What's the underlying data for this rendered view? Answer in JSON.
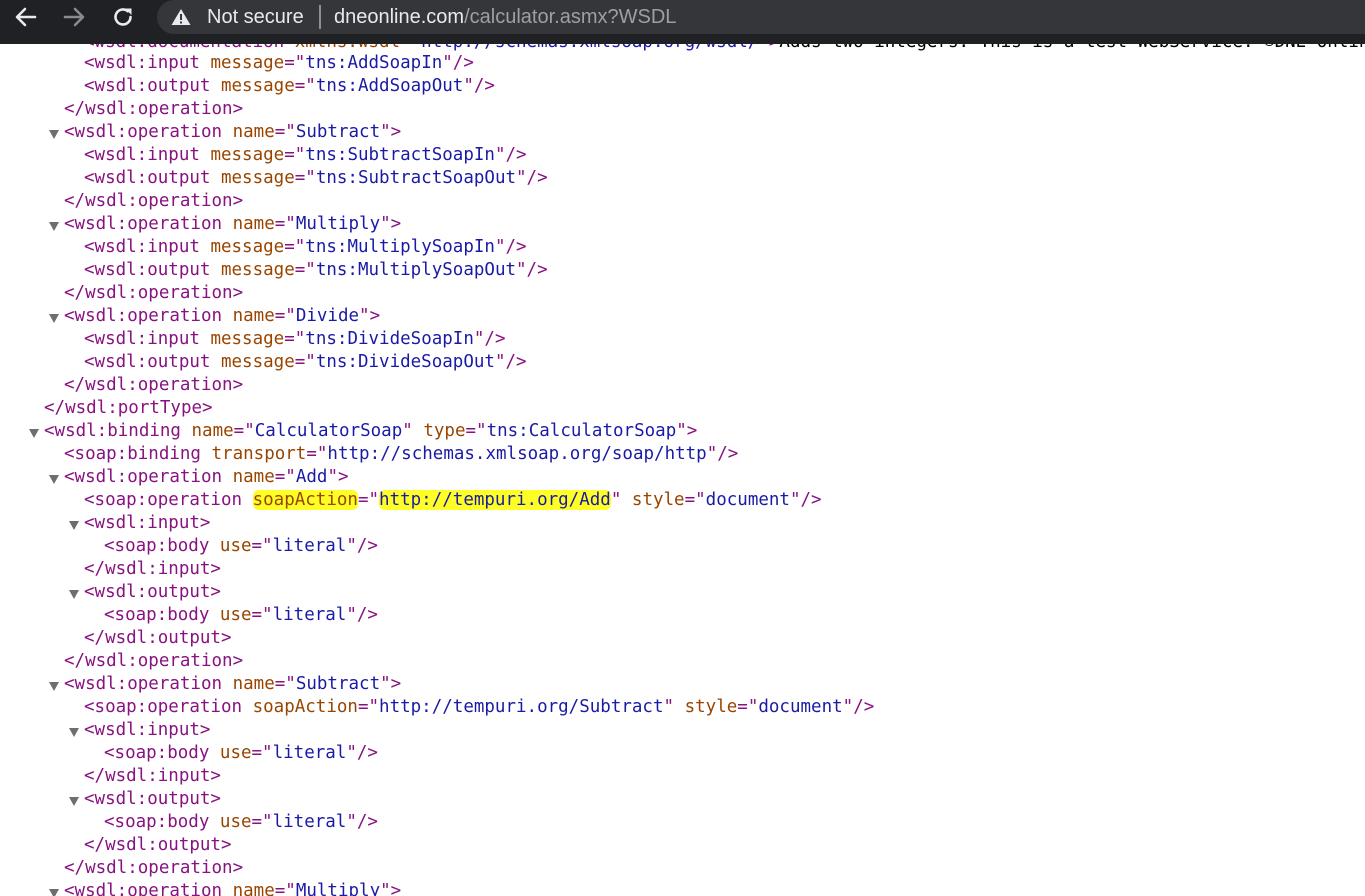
{
  "browser": {
    "security_label": "Not secure",
    "url_host": "dneonline.com",
    "url_path": "/calculator.asmx?WSDL"
  },
  "xml": {
    "doc_partial": {
      "open": "<wsdl:documentation",
      "attr_name": "xmlns:wsdl",
      "attr_value": "http://schemas.xmlsoap.org/wsdl/",
      "text": "Adds two integers. This is a test WebService. ©DNE Online"
    },
    "porttype_add": {
      "input": {
        "tag": "<wsdl:input",
        "attr_name": "message",
        "attr_value": "tns:AddSoapIn"
      },
      "output": {
        "tag": "<wsdl:output",
        "attr_name": "message",
        "attr_value": "tns:AddSoapOut"
      },
      "close": "</wsdl:operation>"
    },
    "porttype_subtract": {
      "open": {
        "tag": "<wsdl:operation",
        "attr_name": "name",
        "attr_value": "Subtract"
      },
      "input": {
        "tag": "<wsdl:input",
        "attr_name": "message",
        "attr_value": "tns:SubtractSoapIn"
      },
      "output": {
        "tag": "<wsdl:output",
        "attr_name": "message",
        "attr_value": "tns:SubtractSoapOut"
      },
      "close": "</wsdl:operation>"
    },
    "porttype_multiply": {
      "open": {
        "tag": "<wsdl:operation",
        "attr_name": "name",
        "attr_value": "Multiply"
      },
      "input": {
        "tag": "<wsdl:input",
        "attr_name": "message",
        "attr_value": "tns:MultiplySoapIn"
      },
      "output": {
        "tag": "<wsdl:output",
        "attr_name": "message",
        "attr_value": "tns:MultiplySoapOut"
      },
      "close": "</wsdl:operation>"
    },
    "porttype_divide": {
      "open": {
        "tag": "<wsdl:operation",
        "attr_name": "name",
        "attr_value": "Divide"
      },
      "input": {
        "tag": "<wsdl:input",
        "attr_name": "message",
        "attr_value": "tns:DivideSoapIn"
      },
      "output": {
        "tag": "<wsdl:output",
        "attr_name": "message",
        "attr_value": "tns:DivideSoapOut"
      },
      "close": "</wsdl:operation>"
    },
    "porttype_close": "</wsdl:portType>",
    "binding": {
      "tag": "<wsdl:binding",
      "name_attr": "name",
      "name_value": "CalculatorSoap",
      "type_attr": "type",
      "type_value": "tns:CalculatorSoap",
      "soap_binding": {
        "tag": "<soap:binding",
        "attr_name": "transport",
        "attr_value": "http://schemas.xmlsoap.org/soap/http"
      }
    },
    "binding_add": {
      "open": {
        "tag": "<wsdl:operation",
        "attr_name": "name",
        "attr_value": "Add"
      },
      "soap_op": {
        "tag": "<soap:operation",
        "action_attr": "soapAction",
        "action_value": "http://tempuri.org/Add",
        "style_attr": "style",
        "style_value": "document"
      },
      "input_open": "<wsdl:input>",
      "input_body": {
        "tag": "<soap:body",
        "attr_name": "use",
        "attr_value": "literal"
      },
      "input_close": "</wsdl:input>",
      "output_open": "<wsdl:output>",
      "output_body": {
        "tag": "<soap:body",
        "attr_name": "use",
        "attr_value": "literal"
      },
      "output_close": "</wsdl:output>",
      "close": "</wsdl:operation>"
    },
    "binding_subtract": {
      "open": {
        "tag": "<wsdl:operation",
        "attr_name": "name",
        "attr_value": "Subtract"
      },
      "soap_op": {
        "tag": "<soap:operation",
        "action_attr": "soapAction",
        "action_value": "http://tempuri.org/Subtract",
        "style_attr": "style",
        "style_value": "document"
      },
      "input_open": "<wsdl:input>",
      "input_body": {
        "tag": "<soap:body",
        "attr_name": "use",
        "attr_value": "literal"
      },
      "input_close": "</wsdl:input>",
      "output_open": "<wsdl:output>",
      "output_body": {
        "tag": "<soap:body",
        "attr_name": "use",
        "attr_value": "literal"
      },
      "output_close": "</wsdl:output>",
      "close": "</wsdl:operation>"
    },
    "binding_multiply": {
      "open": {
        "tag": "<wsdl:operation",
        "attr_name": "name",
        "attr_value": "Multiply"
      }
    }
  }
}
